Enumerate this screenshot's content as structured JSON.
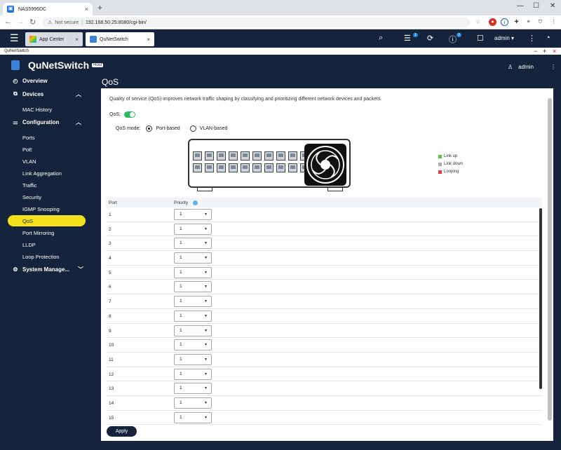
{
  "browser": {
    "tab_title": "NAS5996DC",
    "new_tab": "+",
    "not_secure": "Not secure",
    "url": "192.168.50.25:8080/cgi-bin/"
  },
  "qts": {
    "tabs": [
      {
        "label": "App Center"
      },
      {
        "label": "QuNetSwitch"
      }
    ],
    "badge1": "1",
    "badge2": "3",
    "user": "admin"
  },
  "app": {
    "window_title": "QuNetSwitch",
    "brand": "QuNetSwitch",
    "brand_tag": "Host",
    "user": "admin"
  },
  "sidebar": {
    "overview": "Overview",
    "devices": "Devices",
    "mac_history": "MAC History",
    "configuration": "Configuration",
    "items": [
      "Ports",
      "PoE",
      "VLAN",
      "Link Aggregation",
      "Traffic",
      "Security",
      "IGMP Snooping",
      "QoS",
      "Port Mirroring",
      "LLDP",
      "Loop Protection"
    ],
    "system": "System Manage..."
  },
  "page": {
    "title": "QoS",
    "description": "Quality of service (QoS) improves network traffic shaping by classifying and prioritizing different network devices and packets.",
    "qos_label": "QoS:",
    "qos_enabled": true,
    "mode_label": "QoS mode:",
    "mode_options": [
      "Port-based",
      "VLAN-based"
    ],
    "mode_selected": "Port-based",
    "legend": [
      {
        "label": "Link up",
        "color": "#5cc24a"
      },
      {
        "label": "Link down",
        "color": "#a9a9a9"
      },
      {
        "label": "Looping",
        "color": "#e53935"
      }
    ],
    "table": {
      "col_port": "Port",
      "col_priority": "Priority",
      "rows": [
        {
          "port": "1",
          "priority": "1"
        },
        {
          "port": "2",
          "priority": "1"
        },
        {
          "port": "3",
          "priority": "1"
        },
        {
          "port": "4",
          "priority": "1"
        },
        {
          "port": "5",
          "priority": "1"
        },
        {
          "port": "6",
          "priority": "1"
        },
        {
          "port": "7",
          "priority": "1"
        },
        {
          "port": "8",
          "priority": "1"
        },
        {
          "port": "9",
          "priority": "1"
        },
        {
          "port": "10",
          "priority": "1"
        },
        {
          "port": "11",
          "priority": "1"
        },
        {
          "port": "12",
          "priority": "1"
        },
        {
          "port": "13",
          "priority": "1"
        },
        {
          "port": "14",
          "priority": "1"
        },
        {
          "port": "15",
          "priority": "1"
        }
      ]
    },
    "apply": "Apply"
  }
}
